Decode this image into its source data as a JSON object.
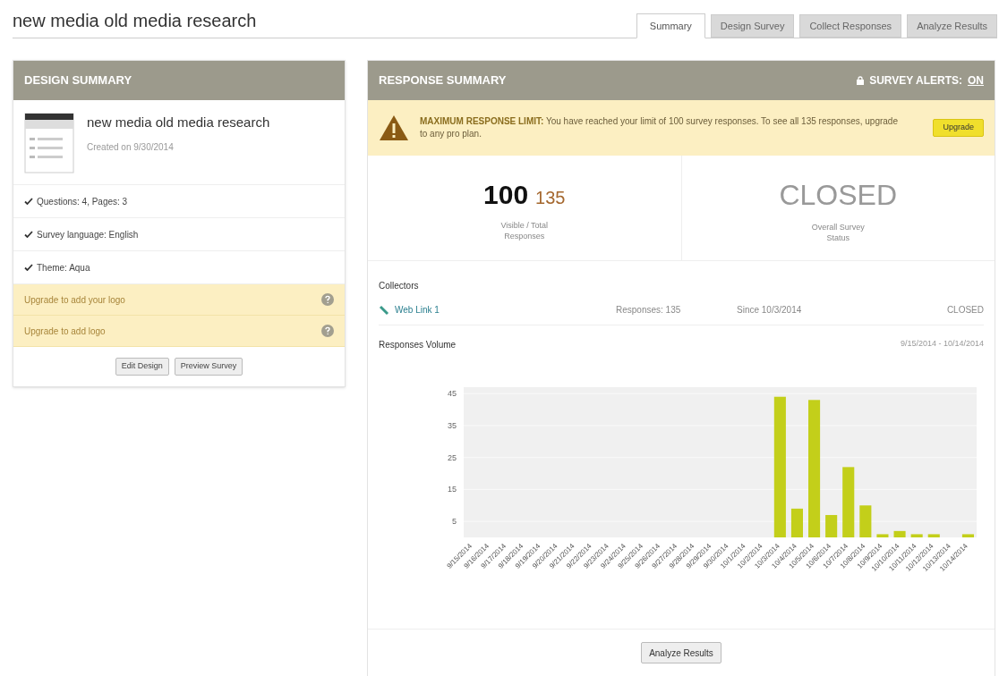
{
  "page_title": "new media old media research",
  "tabs": [
    {
      "label": "Summary",
      "selected": true
    },
    {
      "label": "Design Survey",
      "selected": false
    },
    {
      "label": "Collect Responses",
      "selected": false
    },
    {
      "label": "Analyze Results",
      "selected": false
    }
  ],
  "design_summary": {
    "title": "DESIGN SUMMARY",
    "survey_name": "new media old media research",
    "created": "Created on 9/30/2014",
    "items": [
      {
        "kind": "check",
        "text": "Questions: 4, Pages: 3"
      },
      {
        "kind": "check",
        "text": "Survey language: English"
      },
      {
        "kind": "check",
        "text": "Theme: Aqua"
      },
      {
        "kind": "upgrade",
        "text": "Upgrade to add your logo"
      },
      {
        "kind": "upgrade",
        "text": "Upgrade to add logo"
      }
    ],
    "buttons": [
      "Edit Design",
      "Preview Survey"
    ]
  },
  "response_summary": {
    "title": "RESPONSE SUMMARY",
    "alerts_label": "SURVEY ALERTS:",
    "alerts_state": "ON",
    "alert": {
      "text": "**MAXIMUM RESPONSE LIMIT:** You have reached your limit of 100 survey responses. To see all 135 responses, upgrade to any pro plan.",
      "button": "Upgrade"
    },
    "stats": [
      {
        "value": "100",
        "secondary": "135",
        "label": "Visible / Total Responses"
      },
      {
        "value": "CLOSED",
        "label": "Overall Survey Status"
      }
    ],
    "collectors": {
      "heading": "Collectors",
      "rows": [
        {
          "name": "Web Link 1",
          "responses": "Responses: 135",
          "since": "Since 10/3/2014",
          "status": "CLOSED"
        }
      ]
    },
    "volume": {
      "heading": "Responses Volume",
      "range": "9/15/2014 - 10/14/2014",
      "chart_data": {
        "type": "bar",
        "categories": [
          "9/15/2014",
          "9/16/2014",
          "9/17/2014",
          "9/18/2014",
          "9/19/2014",
          "9/20/2014",
          "9/21/2014",
          "9/22/2014",
          "9/23/2014",
          "9/24/2014",
          "9/25/2014",
          "9/26/2014",
          "9/27/2014",
          "9/28/2014",
          "9/29/2014",
          "9/30/2014",
          "10/1/2014",
          "10/2/2014",
          "10/3/2014",
          "10/4/2014",
          "10/5/2014",
          "10/6/2014",
          "10/7/2014",
          "10/8/2014",
          "10/9/2014",
          "10/10/2014",
          "10/11/2014",
          "10/12/2014",
          "10/13/2014",
          "10/14/2014"
        ],
        "series": [
          {
            "color": "#c3cf1a",
            "values": [
              0,
              0,
              0,
              0,
              0,
              0,
              0,
              0,
              0,
              0,
              0,
              0,
              0,
              0,
              0,
              0,
              0,
              0,
              44,
              9,
              43,
              7,
              22,
              10,
              1,
              2,
              1,
              1,
              0,
              1
            ]
          }
        ],
        "ylim": [
          0,
          47
        ],
        "yticks": [
          5,
          15,
          25,
          35,
          45
        ],
        "grid": true
      }
    },
    "button": "Analyze Results"
  }
}
